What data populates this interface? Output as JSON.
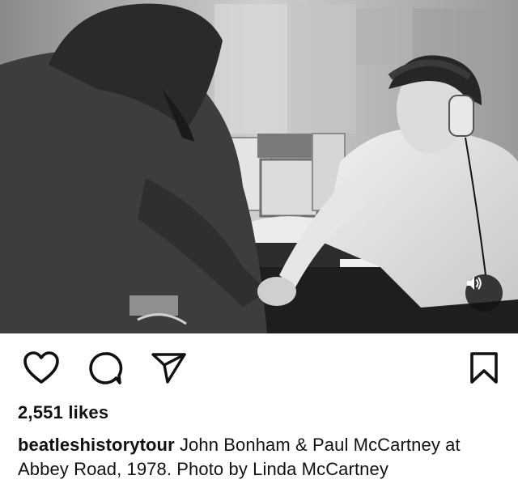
{
  "post": {
    "media": {
      "alt_subject": "Black and white studio photo",
      "sound_icon": "speaker-volume-icon"
    },
    "actions": {
      "like_icon": "heart-icon",
      "comment_icon": "comment-bubble-icon",
      "share_icon": "paper-plane-icon",
      "save_icon": "bookmark-icon"
    },
    "likes_text": "2,551 likes",
    "caption": {
      "username": "beatleshistorytour",
      "text": "John Bonham & Paul McCartney at Abbey Road, 1978. Photo by Linda McCartney"
    }
  }
}
